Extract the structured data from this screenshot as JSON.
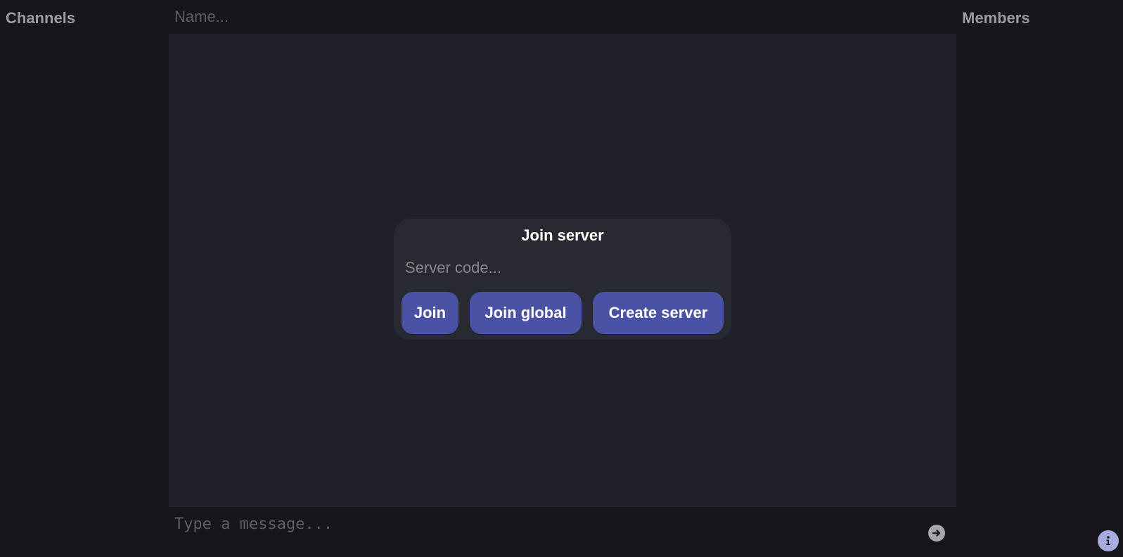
{
  "sidebar_left": {
    "title": "Channels"
  },
  "sidebar_right": {
    "title": "Members"
  },
  "name_input": {
    "placeholder": "Name...",
    "value": ""
  },
  "dialog": {
    "title": "Join server",
    "server_code_placeholder": "Server code...",
    "buttons": {
      "join": "Join",
      "join_global": "Join global",
      "create_server": "Create server"
    }
  },
  "message_input": {
    "placeholder": "Type a message...",
    "value": ""
  },
  "icons": {
    "send": "arrow-right-circle-icon",
    "info": "info-icon"
  },
  "colors": {
    "background": "#16161c",
    "chat_area": "#21212b",
    "dialog": "#292932",
    "button": "#4a52a6",
    "info_accent": "#a8abe0"
  }
}
